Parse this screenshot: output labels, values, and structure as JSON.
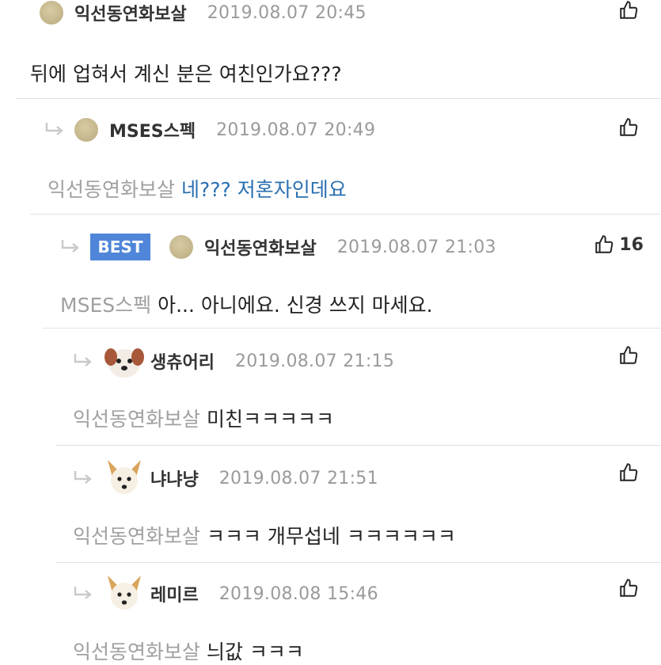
{
  "comments": [
    {
      "author": "익선동연화보살",
      "time": "2019.08.07 20:45",
      "mention": "",
      "text": "뒤에 업혀서 계신 분은 여친인가요???",
      "likes": "",
      "best": ""
    },
    {
      "author": "MSES스펙",
      "time": "2019.08.07 20:49",
      "mention": "익선동연화보살",
      "text": "네??? 저혼자인데요",
      "likes": "",
      "best": ""
    },
    {
      "author": "익선동연화보살",
      "time": "2019.08.07 21:03",
      "mention": "MSES스펙",
      "text": "아... 아니에요. 신경 쓰지 마세요.",
      "likes": "16",
      "best": "BEST"
    },
    {
      "author": "생츄어리",
      "time": "2019.08.07 21:15",
      "mention": "익선동연화보살",
      "text": "미친ㅋㅋㅋㅋㅋ",
      "likes": "",
      "best": ""
    },
    {
      "author": "냐냐냥",
      "time": "2019.08.07 21:51",
      "mention": "익선동연화보살",
      "text": "ㅋㅋㅋ 개무섭네 ㅋㅋㅋㅋㅋㅋ",
      "likes": "",
      "best": ""
    },
    {
      "author": "레미르",
      "time": "2019.08.08 15:46",
      "mention": "익선동연화보살",
      "text": "늬값 ㅋㅋㅋ",
      "likes": "",
      "best": ""
    }
  ],
  "icons": {
    "like": "thumbs-up-icon",
    "reply": "reply-arrow-icon",
    "avatar_default": "avatar-dot",
    "avatar_dog": "dog-face-avatar"
  },
  "colors": {
    "best_badge": "#4f86d9",
    "mention": "#a0a0a0",
    "reply_text_blue": "#2a6fb0",
    "time": "#9a9a9a"
  }
}
